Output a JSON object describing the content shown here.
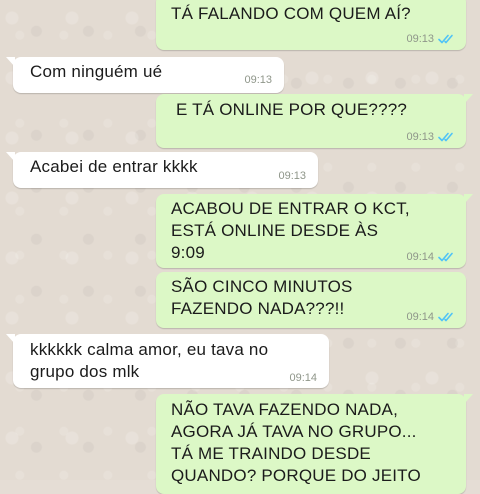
{
  "messages": [
    {
      "from": "me",
      "text": "TÁ FALANDO COM QUEM AÍ?",
      "time": "09:13"
    },
    {
      "from": "them",
      "text": "Com ninguém ué",
      "time": "09:13"
    },
    {
      "from": "me",
      "text": "E TÁ ONLINE POR QUE????",
      "time": "09:13"
    },
    {
      "from": "them",
      "text": "Acabei de entrar kkkk",
      "time": "09:13"
    },
    {
      "from": "me",
      "text": "ACABOU DE ENTRAR O KCT,\nESTÁ ONLINE DESDE ÀS\n9:09",
      "time": "09:14"
    },
    {
      "from": "me",
      "text": "SÃO CINCO MINUTOS\nFAZENDO NADA???!!",
      "time": "09:14"
    },
    {
      "from": "them",
      "text": "kkkkkk calma amor, eu tava no\ngrupo dos mlk",
      "time": "09:14"
    },
    {
      "from": "me",
      "text": "NÃO TAVA FAZENDO NADA,\nAGORA JÁ TAVA NO GRUPO...\nTÁ ME TRAINDO DESDE\nQUANDO? PORQUE DO JEITO",
      "time": ""
    }
  ],
  "icons": {
    "read_receipt": "double-check-icon"
  },
  "colors": {
    "outgoing_bubble": "#dcf8c6",
    "incoming_bubble": "#ffffff",
    "read_ticks": "#4fc3f7",
    "background": "#e5ddd5"
  }
}
